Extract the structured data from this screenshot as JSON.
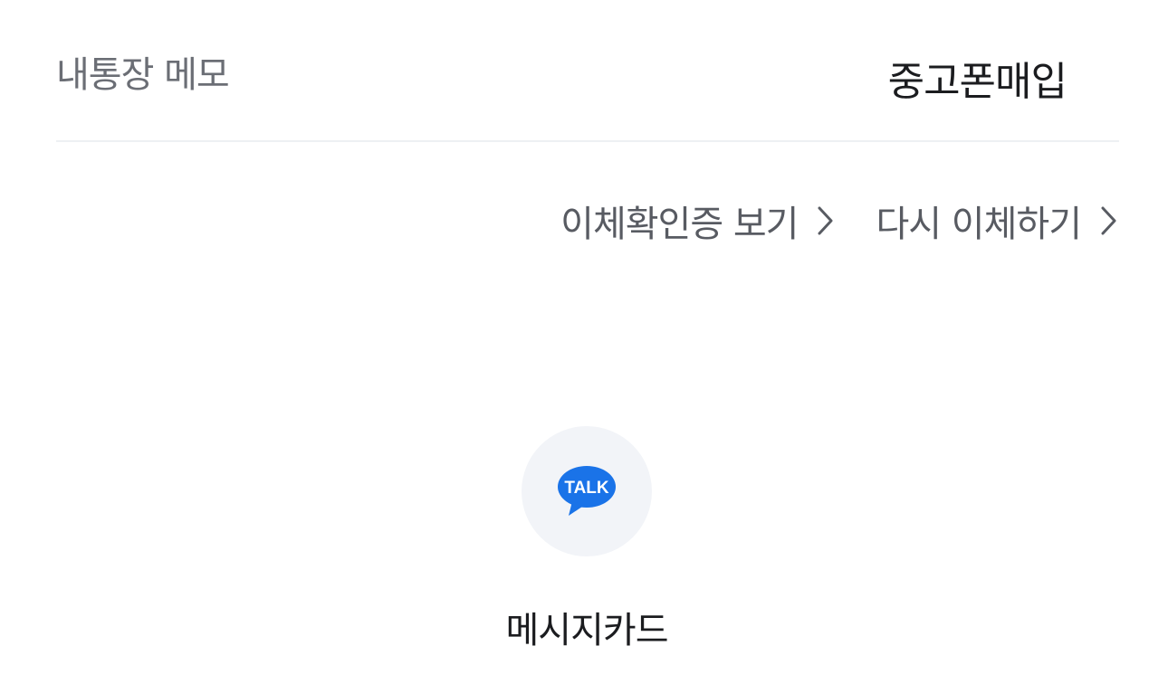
{
  "memo": {
    "label": "내통장 메모",
    "value": "중고폰매입"
  },
  "links": {
    "receipt_label": "이체확인증 보기",
    "retransfer_label": "다시 이체하기",
    "chevron_icon": "chevron-right-icon"
  },
  "share": {
    "icon": "kakaotalk-talk-icon",
    "icon_text": "TALK",
    "label": "메시지카드",
    "icon_color": "#1a73e8",
    "circle_color": "#f2f4f8"
  }
}
